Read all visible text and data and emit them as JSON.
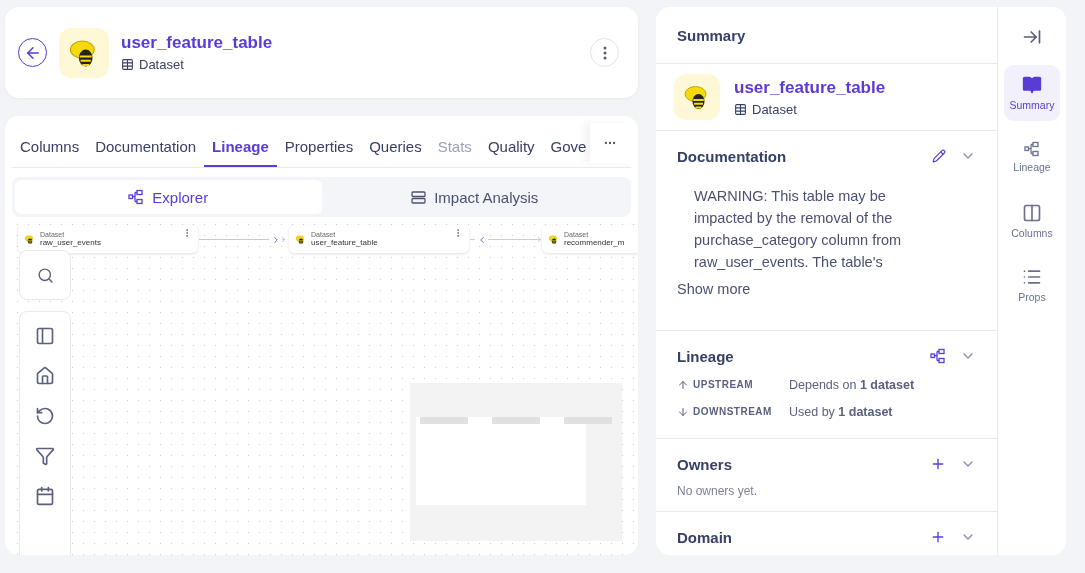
{
  "header": {
    "title": "user_feature_table",
    "type": "Dataset"
  },
  "tabs": [
    {
      "label": "Columns",
      "selected": false,
      "disabled": false
    },
    {
      "label": "Documentation",
      "selected": false,
      "disabled": false
    },
    {
      "label": "Lineage",
      "selected": true,
      "disabled": false
    },
    {
      "label": "Properties",
      "selected": false,
      "disabled": false
    },
    {
      "label": "Queries",
      "selected": false,
      "disabled": false
    },
    {
      "label": "Stats",
      "selected": false,
      "disabled": true
    },
    {
      "label": "Quality",
      "selected": false,
      "disabled": false
    },
    {
      "label": "Gove",
      "selected": false,
      "disabled": false
    }
  ],
  "view_toggle": [
    {
      "label": "Explorer",
      "selected": true,
      "kind": "explorer"
    },
    {
      "label": "Impact Analysis",
      "selected": false,
      "kind": "impact"
    }
  ],
  "lineage_nodes": [
    {
      "type": "Dataset",
      "name": "raw_user_events"
    },
    {
      "type": "Dataset",
      "name": "user_feature_table"
    },
    {
      "type": "Dataset",
      "name": "recommender_m"
    }
  ],
  "summary": {
    "heading": "Summary",
    "title": "user_feature_table",
    "type": "Dataset",
    "documentation": {
      "heading": "Documentation",
      "text": "WARNING: This table may be\nimpacted by the removal of the\npurchase_category column from\nraw_user_events. The table's",
      "show_more": "Show more"
    },
    "lineage": {
      "heading": "Lineage",
      "rows": [
        {
          "kind": "up",
          "label": "UPSTREAM",
          "text": "Depends on **1 dataset**"
        },
        {
          "kind": "down",
          "label": "DOWNSTREAM",
          "text": "Used by **1 dataset**"
        }
      ]
    },
    "owners": {
      "heading": "Owners",
      "empty": "No owners yet."
    },
    "domain": {
      "heading": "Domain"
    }
  },
  "rail": [
    {
      "label": "Summary",
      "selected": true,
      "kind": "summary"
    },
    {
      "label": "Lineage",
      "selected": false,
      "kind": "lineage"
    },
    {
      "label": "Columns",
      "selected": false,
      "kind": "columns"
    },
    {
      "label": "Props",
      "selected": false,
      "kind": "props"
    }
  ]
}
